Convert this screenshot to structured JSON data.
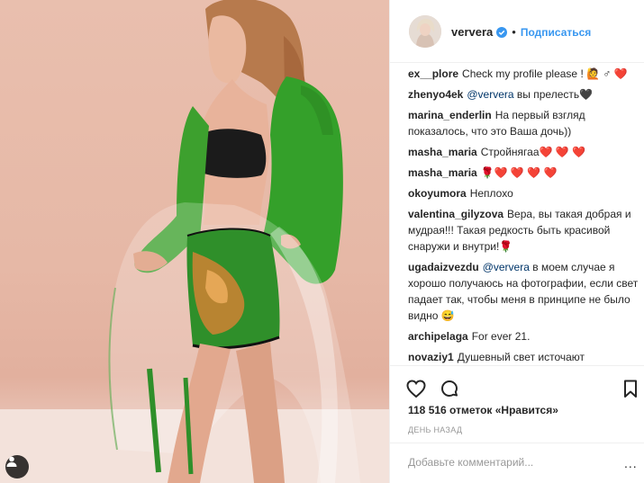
{
  "post": {
    "username": "ververa",
    "separator": "•",
    "follow_label": "Подписаться",
    "likes_text": "118 516 отметок «Нравится»",
    "time_text": "ДЕНЬ НАЗАД",
    "add_comment_placeholder": "Добавьте комментарий...",
    "more_label": "..."
  },
  "comments": [
    {
      "user": "ex__plore",
      "mention": "",
      "text": "Check my profile please ! 🙋 ♂ ❤️"
    },
    {
      "user": "zhenyo4ek",
      "mention": "@ververa",
      "text": "вы прелесть🖤"
    },
    {
      "user": "marina_enderlin",
      "mention": "",
      "text": "На первый взгляд показалось, что это Ваша дочь))"
    },
    {
      "user": "masha_maria",
      "mention": "",
      "text": "Стройнягаа❤️ ❤️ ❤️"
    },
    {
      "user": "masha_maria",
      "mention": "",
      "text": "🌹❤️ ❤️ ❤️ ❤️"
    },
    {
      "user": "okoyumora",
      "mention": "",
      "text": "Неплохо"
    },
    {
      "user": "valentina_gilyzova",
      "mention": "",
      "text": "Вера, вы такая добрая и мудрая!!! Такая редкость быть красивой снаружи и внутри!🌹"
    },
    {
      "user": "ugadaizvezdu",
      "mention": "@ververa",
      "text": "в моем случае я хорошо получаюсь на фотографии, если свет падает так, чтобы меня в принципе не было видно 😅"
    },
    {
      "user": "archipelaga",
      "mention": "",
      "text": "For ever 21."
    },
    {
      "user": "novaziy1",
      "mention": "",
      "text": "Душевный свет источают благодеяния. Хотя, красота - предмет"
    }
  ],
  "icons": {
    "verified": "verified-badge-icon",
    "like": "heart-icon",
    "comment": "comment-bubble-icon",
    "save": "bookmark-icon",
    "tag": "user-tag-icon"
  },
  "colors": {
    "accent": "#3897f0",
    "mention": "#003569",
    "text": "#262626",
    "muted": "#999999",
    "border": "#efefef"
  }
}
